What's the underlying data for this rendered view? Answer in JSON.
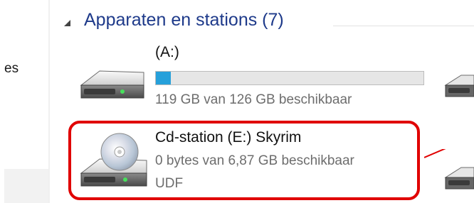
{
  "nav": {
    "item_label": "es"
  },
  "group": {
    "title": "Apparaten en stations (7)"
  },
  "drives": [
    {
      "name": "(A:)",
      "free_text": "119 GB van 126 GB beschikbaar",
      "used_fraction": 0.056,
      "icon": "hard-drive-icon"
    },
    {
      "name": "Cd-station (E:) Skyrim",
      "free_text": "0 bytes van 6,87 GB beschikbaar",
      "filesystem": "UDF",
      "icon": "cd-drive-icon"
    }
  ],
  "colors": {
    "accent": "#26a0da",
    "highlight": "#e00000",
    "group_title": "#1e3a8a"
  }
}
